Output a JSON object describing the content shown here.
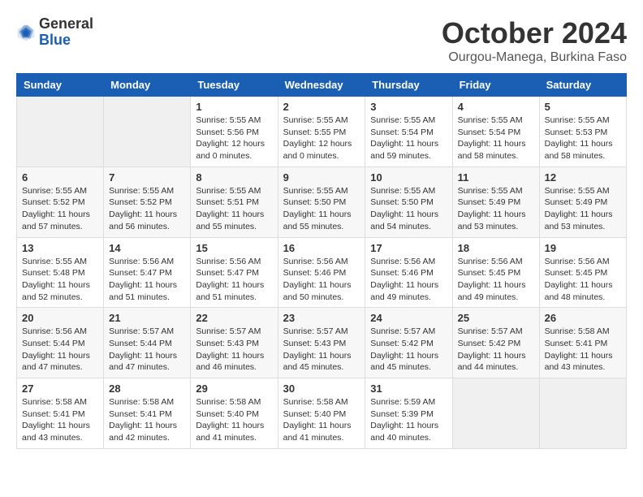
{
  "header": {
    "logo": {
      "general": "General",
      "blue": "Blue"
    },
    "title": "October 2024",
    "subtitle": "Ourgou-Manega, Burkina Faso"
  },
  "days_of_week": [
    "Sunday",
    "Monday",
    "Tuesday",
    "Wednesday",
    "Thursday",
    "Friday",
    "Saturday"
  ],
  "weeks": [
    [
      {
        "day": "",
        "info": ""
      },
      {
        "day": "",
        "info": ""
      },
      {
        "day": "1",
        "info": "Sunrise: 5:55 AM\nSunset: 5:56 PM\nDaylight: 12 hours\nand 0 minutes."
      },
      {
        "day": "2",
        "info": "Sunrise: 5:55 AM\nSunset: 5:55 PM\nDaylight: 12 hours\nand 0 minutes."
      },
      {
        "day": "3",
        "info": "Sunrise: 5:55 AM\nSunset: 5:54 PM\nDaylight: 11 hours\nand 59 minutes."
      },
      {
        "day": "4",
        "info": "Sunrise: 5:55 AM\nSunset: 5:54 PM\nDaylight: 11 hours\nand 58 minutes."
      },
      {
        "day": "5",
        "info": "Sunrise: 5:55 AM\nSunset: 5:53 PM\nDaylight: 11 hours\nand 58 minutes."
      }
    ],
    [
      {
        "day": "6",
        "info": "Sunrise: 5:55 AM\nSunset: 5:52 PM\nDaylight: 11 hours\nand 57 minutes."
      },
      {
        "day": "7",
        "info": "Sunrise: 5:55 AM\nSunset: 5:52 PM\nDaylight: 11 hours\nand 56 minutes."
      },
      {
        "day": "8",
        "info": "Sunrise: 5:55 AM\nSunset: 5:51 PM\nDaylight: 11 hours\nand 55 minutes."
      },
      {
        "day": "9",
        "info": "Sunrise: 5:55 AM\nSunset: 5:50 PM\nDaylight: 11 hours\nand 55 minutes."
      },
      {
        "day": "10",
        "info": "Sunrise: 5:55 AM\nSunset: 5:50 PM\nDaylight: 11 hours\nand 54 minutes."
      },
      {
        "day": "11",
        "info": "Sunrise: 5:55 AM\nSunset: 5:49 PM\nDaylight: 11 hours\nand 53 minutes."
      },
      {
        "day": "12",
        "info": "Sunrise: 5:55 AM\nSunset: 5:49 PM\nDaylight: 11 hours\nand 53 minutes."
      }
    ],
    [
      {
        "day": "13",
        "info": "Sunrise: 5:55 AM\nSunset: 5:48 PM\nDaylight: 11 hours\nand 52 minutes."
      },
      {
        "day": "14",
        "info": "Sunrise: 5:56 AM\nSunset: 5:47 PM\nDaylight: 11 hours\nand 51 minutes."
      },
      {
        "day": "15",
        "info": "Sunrise: 5:56 AM\nSunset: 5:47 PM\nDaylight: 11 hours\nand 51 minutes."
      },
      {
        "day": "16",
        "info": "Sunrise: 5:56 AM\nSunset: 5:46 PM\nDaylight: 11 hours\nand 50 minutes."
      },
      {
        "day": "17",
        "info": "Sunrise: 5:56 AM\nSunset: 5:46 PM\nDaylight: 11 hours\nand 49 minutes."
      },
      {
        "day": "18",
        "info": "Sunrise: 5:56 AM\nSunset: 5:45 PM\nDaylight: 11 hours\nand 49 minutes."
      },
      {
        "day": "19",
        "info": "Sunrise: 5:56 AM\nSunset: 5:45 PM\nDaylight: 11 hours\nand 48 minutes."
      }
    ],
    [
      {
        "day": "20",
        "info": "Sunrise: 5:56 AM\nSunset: 5:44 PM\nDaylight: 11 hours\nand 47 minutes."
      },
      {
        "day": "21",
        "info": "Sunrise: 5:57 AM\nSunset: 5:44 PM\nDaylight: 11 hours\nand 47 minutes."
      },
      {
        "day": "22",
        "info": "Sunrise: 5:57 AM\nSunset: 5:43 PM\nDaylight: 11 hours\nand 46 minutes."
      },
      {
        "day": "23",
        "info": "Sunrise: 5:57 AM\nSunset: 5:43 PM\nDaylight: 11 hours\nand 45 minutes."
      },
      {
        "day": "24",
        "info": "Sunrise: 5:57 AM\nSunset: 5:42 PM\nDaylight: 11 hours\nand 45 minutes."
      },
      {
        "day": "25",
        "info": "Sunrise: 5:57 AM\nSunset: 5:42 PM\nDaylight: 11 hours\nand 44 minutes."
      },
      {
        "day": "26",
        "info": "Sunrise: 5:58 AM\nSunset: 5:41 PM\nDaylight: 11 hours\nand 43 minutes."
      }
    ],
    [
      {
        "day": "27",
        "info": "Sunrise: 5:58 AM\nSunset: 5:41 PM\nDaylight: 11 hours\nand 43 minutes."
      },
      {
        "day": "28",
        "info": "Sunrise: 5:58 AM\nSunset: 5:41 PM\nDaylight: 11 hours\nand 42 minutes."
      },
      {
        "day": "29",
        "info": "Sunrise: 5:58 AM\nSunset: 5:40 PM\nDaylight: 11 hours\nand 41 minutes."
      },
      {
        "day": "30",
        "info": "Sunrise: 5:58 AM\nSunset: 5:40 PM\nDaylight: 11 hours\nand 41 minutes."
      },
      {
        "day": "31",
        "info": "Sunrise: 5:59 AM\nSunset: 5:39 PM\nDaylight: 11 hours\nand 40 minutes."
      },
      {
        "day": "",
        "info": ""
      },
      {
        "day": "",
        "info": ""
      }
    ]
  ]
}
